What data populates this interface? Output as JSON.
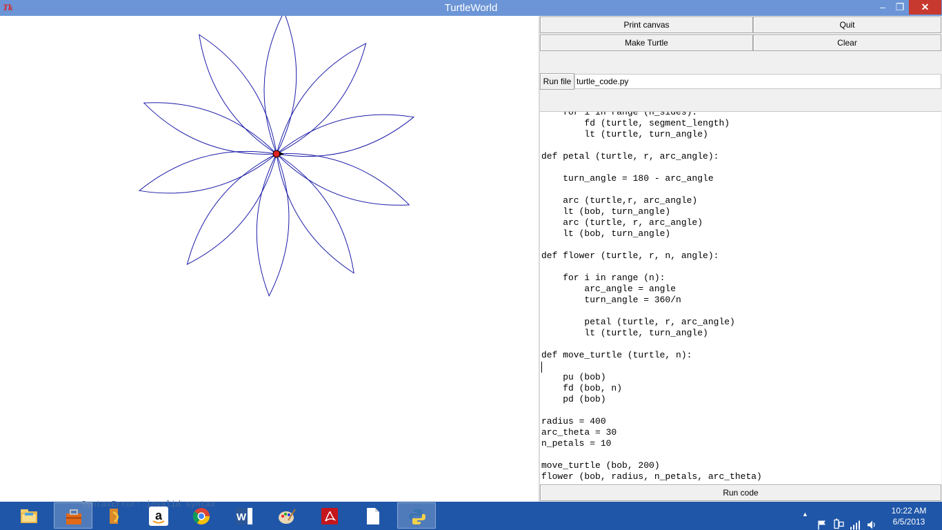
{
  "window": {
    "title": "TurtleWorld",
    "tk_logo": "Tk",
    "min_glyph": "–",
    "max_glyph": "❐",
    "close_glyph": "✕"
  },
  "toolbar": {
    "print_canvas": "Print canvas",
    "quit": "Quit",
    "make_turtle": "Make Turtle",
    "clear": "Clear",
    "run_file": "Run file",
    "file_name": "turtle_code.py",
    "run_code": "Run code"
  },
  "editor": {
    "code": "    for i in range (n_sides):\n        fd (turtle, segment_length)\n        lt (turtle, turn_angle)\n\ndef petal (turtle, r, arc_angle):\n\n    turn_angle = 180 - arc_angle\n\n    arc (turtle,r, arc_angle)\n    lt (bob, turn_angle)\n    arc (turtle, r, arc_angle)\n    lt (bob, turn_angle)\n\ndef flower (turtle, r, n, angle):\n\n    for i in range (n):\n        arc_angle = angle\n        turn_angle = 360/n\n\n        petal (turtle, r, arc_angle)\n        lt (turtle, turn_angle)\n\ndef move_turtle (turtle, n):\n\n    pu (bob)\n    fd (bob, n)\n    pd (bob)\n\nradius = 400\narc_theta = 30\nn_petals = 10\n\nmove_turtle (bob, 200)\nflower (bob, radius, n_petals, arc_theta)"
  },
  "drawing": {
    "petals": 10,
    "stroke_color": "#1a1aa8",
    "turtle_color": "#e02020"
  },
  "taskbar": {
    "ghost_text": "SyntaxError: invalid syntax",
    "apps": [
      "file-explorer-icon",
      "toolbox-icon",
      "media-player-icon",
      "amazon-icon",
      "chrome-icon",
      "word-icon",
      "paint-icon",
      "acrobat-icon",
      "blank-file-icon",
      "python-icon"
    ],
    "clock_time": "10:22 AM",
    "clock_date": "6/5/2013",
    "tray_chevron": "▲"
  }
}
